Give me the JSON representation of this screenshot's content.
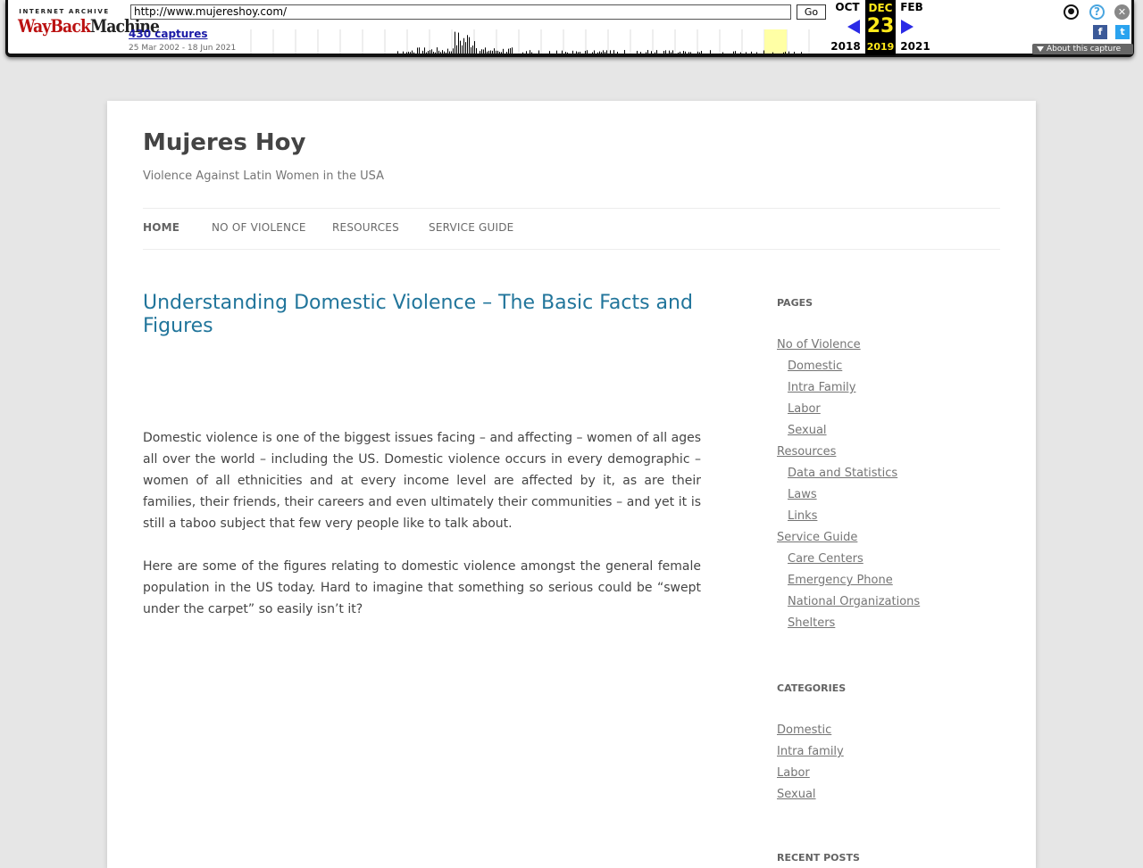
{
  "wayback": {
    "logo_top": "INTERNET ARCHIVE",
    "logo_wayback": "WayBack",
    "logo_machine": "Machine",
    "url": "http://www.mujereshoy.com/",
    "go_label": "Go",
    "captures": "430 captures",
    "range": "25 Mar 2002 - 18 Jun 2021",
    "prev_month": "OCT",
    "prev_year": "2018",
    "cur_month": "DEC",
    "cur_day": "23",
    "cur_year": "2019",
    "next_month": "FEB",
    "next_year": "2021",
    "about": "About this capture",
    "colors": {
      "accent": "#2a2ae6",
      "highlight": "#ffe91a",
      "logo_red": "#bb1111"
    }
  },
  "site": {
    "title": "Mujeres Hoy",
    "description": "Violence Against Latin Women in the USA"
  },
  "nav": {
    "items": [
      "HOME",
      "NO OF VIOLENCE",
      "RESOURCES",
      "SERVICE GUIDE"
    ]
  },
  "post": {
    "title": "Understanding Domestic Violence – The Basic Facts and Figures",
    "paragraphs": [
      "Domestic violence is one of the biggest issues facing – and affecting – women of all ages all over the world – including the US. Domestic violence occurs in every demographic – women of all ethnicities and at every income level are affected by it, as are their families, their friends, their careers and even ultimately their communities – and yet it is still a taboo subject that few very people like to talk about.",
      "Here are some of the figures relating to domestic violence amongst the general female population in the US today. Hard to imagine that something so serious could be “swept under the carpet” so easily isn’t it?"
    ]
  },
  "sidebar": {
    "pages_title": "PAGES",
    "pages": [
      {
        "label": "No of Violence",
        "level": 0
      },
      {
        "label": "Domestic",
        "level": 1
      },
      {
        "label": "Intra Family",
        "level": 1
      },
      {
        "label": "Labor",
        "level": 1
      },
      {
        "label": "Sexual",
        "level": 1
      },
      {
        "label": "Resources",
        "level": 0
      },
      {
        "label": "Data and Statistics",
        "level": 1
      },
      {
        "label": "Laws",
        "level": 1
      },
      {
        "label": "Links",
        "level": 1
      },
      {
        "label": "Service Guide",
        "level": 0
      },
      {
        "label": "Care Centers",
        "level": 1
      },
      {
        "label": "Emergency Phone",
        "level": 1
      },
      {
        "label": "National Organizations",
        "level": 1
      },
      {
        "label": "Shelters",
        "level": 1
      }
    ],
    "categories_title": "CATEGORIES",
    "categories": [
      "Domestic",
      "Intra family",
      "Labor",
      "Sexual"
    ],
    "recent_title": "RECENT POSTS"
  }
}
